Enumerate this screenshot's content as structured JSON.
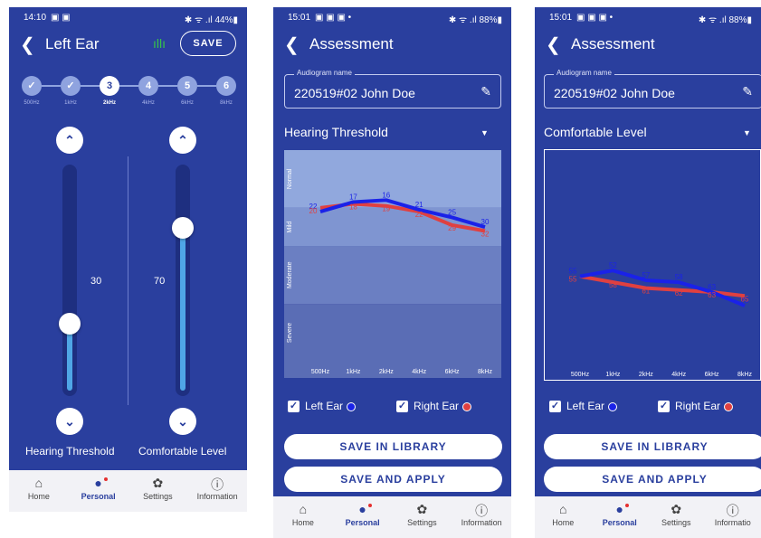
{
  "colors": {
    "bg": "#2a3f9e",
    "left_ear": "#1a22e8",
    "right_ear": "#e04040",
    "track_fill": "#4fa6e6",
    "nav_bg": "#f2f2f6"
  },
  "screen1": {
    "status_time": "14:10",
    "status_icons": "▣ ▣",
    "status_right": "✱ ᯤ .ıl 44%▮",
    "back_icon": "❮",
    "title": "Left Ear",
    "save": "SAVE",
    "wave_icon": "ıllı",
    "freqs": [
      {
        "step": "✓",
        "label": "500Hz",
        "state": "done"
      },
      {
        "step": "✓",
        "label": "1kHz",
        "state": "done"
      },
      {
        "step": "3",
        "label": "2kHz",
        "state": "active"
      },
      {
        "step": "4",
        "label": "4kHz",
        "state": "pending"
      },
      {
        "step": "5",
        "label": "6kHz",
        "state": "pending"
      },
      {
        "step": "6",
        "label": "8kHz",
        "state": "pending"
      }
    ],
    "up_icon": "⌃",
    "down_icon": "⌄",
    "threshold_value": "30",
    "comfortable_value": "70",
    "threshold_label": "Hearing Threshold",
    "comfortable_label": "Comfortable Level",
    "threshold_level": 0.3,
    "comfortable_level": 0.74
  },
  "screen2": {
    "status_time": "15:01",
    "status_icons": "▣ ▣ ▣ •",
    "status_right": "✱ ᯤ .ıl 88%▮",
    "title": "Assessment",
    "name_legend": "Audiogram name",
    "name_value": "220519#02 John Doe",
    "dropdown": "Hearing Threshold",
    "dd_arrow": "▼",
    "left_ear_label": "Left Ear",
    "right_ear_label": "Right Ear",
    "check": "✓",
    "save_library": "SAVE IN LIBRARY",
    "save_apply": "SAVE AND APPLY"
  },
  "screen3": {
    "status_time": "15:01",
    "status_icons": "▣ ▣ ▣ •",
    "status_right": "✱ ᯤ .ıl 88%▮",
    "title": "Assessment",
    "name_legend": "Audiogram name",
    "name_value": "220519#02 John Doe",
    "dropdown": "Comfortable Level",
    "dd_arrow": "▼",
    "left_ear_label": "Left Ear",
    "right_ear_label": "Right Ear",
    "check": "✓",
    "save_library": "SAVE IN LIBRARY",
    "save_apply": "SAVE AND APPLY"
  },
  "nav": {
    "items": [
      {
        "label": "Home",
        "icon": "⌂"
      },
      {
        "label": "Personal",
        "icon": "●"
      },
      {
        "label": "Settings",
        "icon": "✿"
      },
      {
        "label": "Information",
        "icon": "ⓘ"
      }
    ],
    "nav3_info": "Informatio"
  },
  "chart_data": [
    {
      "type": "line",
      "title": "Hearing Threshold",
      "categories": [
        "500Hz",
        "1kHz",
        "2kHz",
        "4kHz",
        "6kHz",
        "8kHz"
      ],
      "bands": [
        "Normal",
        "Mild",
        "Moderate",
        "Severe"
      ],
      "band_ranges": [
        [
          -10,
          20
        ],
        [
          20,
          40
        ],
        [
          40,
          70
        ],
        [
          70,
          100
        ]
      ],
      "ylim": [
        -10,
        100
      ],
      "series": [
        {
          "name": "Left Ear",
          "color": "#1a22e8",
          "values": [
            22,
            17,
            16,
            21,
            25,
            30
          ]
        },
        {
          "name": "Right Ear",
          "color": "#e04040",
          "values": [
            20,
            18,
            19,
            22,
            29,
            32
          ]
        }
      ]
    },
    {
      "type": "line",
      "title": "Comfortable Level",
      "categories": [
        "500Hz",
        "1kHz",
        "2kHz",
        "4kHz",
        "6kHz",
        "8kHz"
      ],
      "ylim": [
        -10,
        100
      ],
      "series": [
        {
          "name": "Left Ear",
          "color": "#1a22e8",
          "values": [
            55,
            52,
            57,
            58,
            63,
            70
          ]
        },
        {
          "name": "Right Ear",
          "color": "#e04040",
          "values": [
            55,
            58,
            61,
            62,
            63,
            65
          ]
        }
      ]
    }
  ]
}
